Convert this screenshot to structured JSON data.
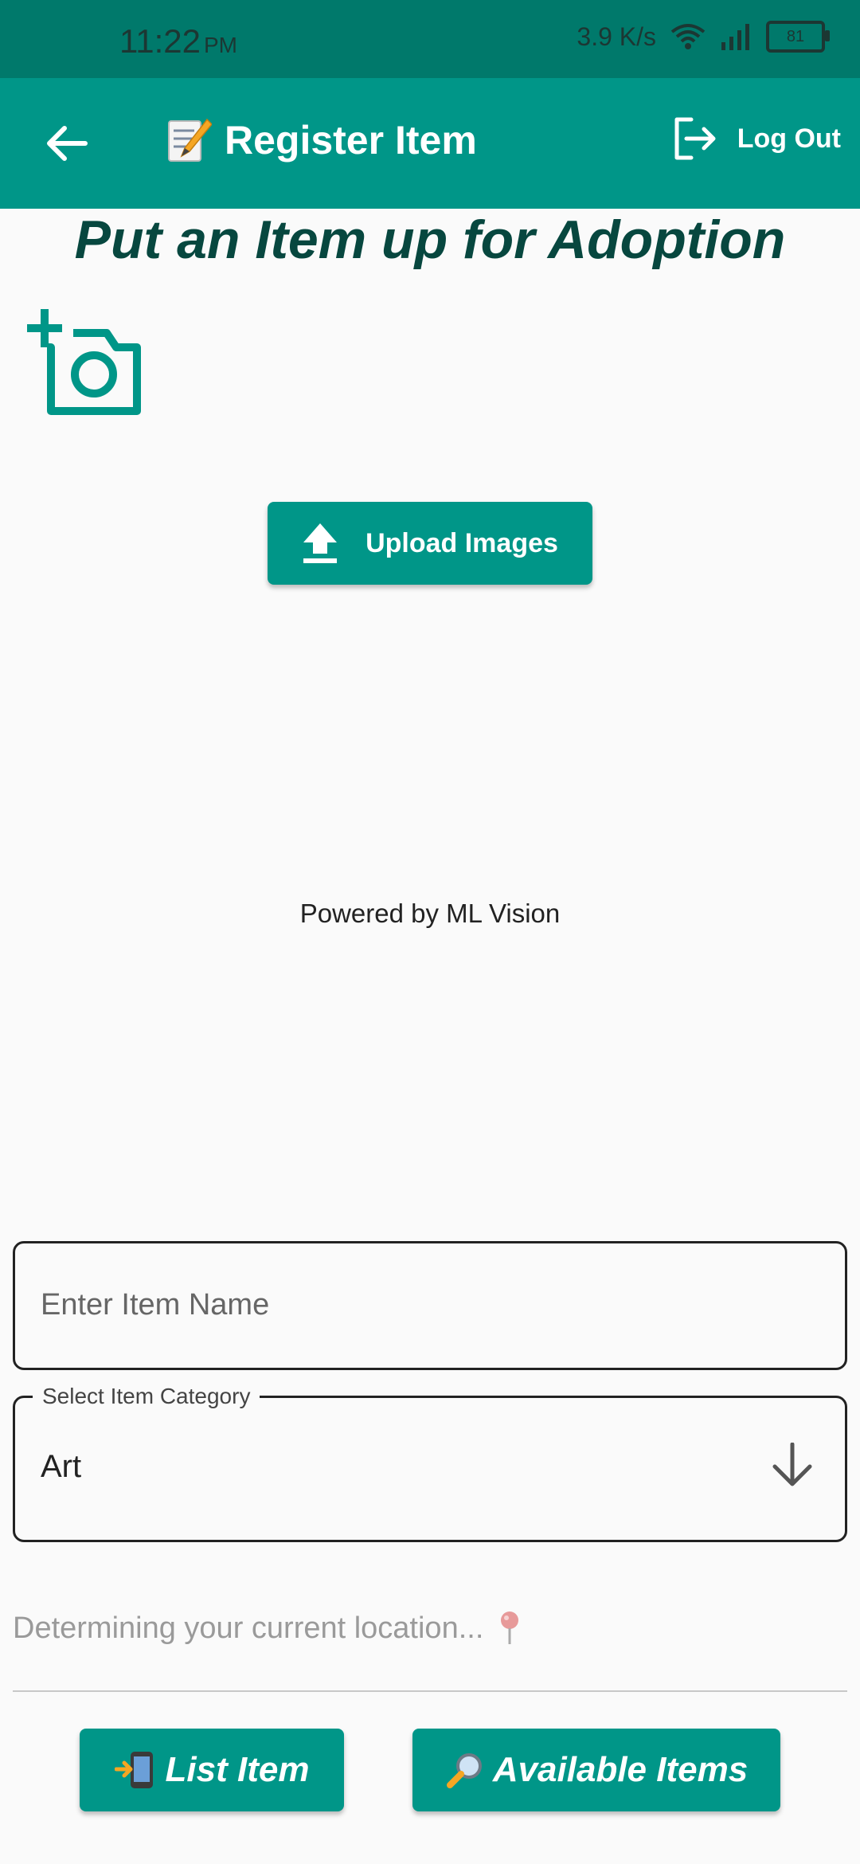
{
  "status_bar": {
    "time": "11:22",
    "ampm": "PM",
    "network_speed": "3.9 K/s",
    "battery": "81"
  },
  "app_bar": {
    "title": "Register Item",
    "logout_label": "Log Out"
  },
  "main": {
    "headline": "Put an Item up for Adoption",
    "upload_button_label": "Upload Images",
    "powered_by": "Powered by ML Vision"
  },
  "form": {
    "item_name_placeholder": "Enter Item Name",
    "category_label": "Select Item Category",
    "category_value": "Art",
    "location_status": "Determining your current location..."
  },
  "actions": {
    "list_item_label": "List Item",
    "available_items_label": "Available Items"
  },
  "colors": {
    "status_bar": "#00796b",
    "app_bar": "#009688",
    "headline": "#07473f",
    "button": "#009688"
  },
  "icons": [
    "back-arrow-icon",
    "memo-icon",
    "logout-icon",
    "add-photo-icon",
    "upload-icon",
    "chevron-down-icon",
    "pin-icon",
    "phone-arrow-icon",
    "magnifier-icon"
  ]
}
